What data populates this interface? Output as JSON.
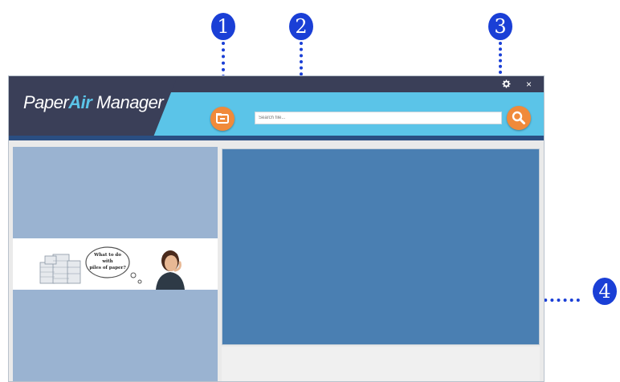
{
  "callouts": [
    {
      "number": "1"
    },
    {
      "number": "2"
    },
    {
      "number": "3"
    },
    {
      "number": "4"
    }
  ],
  "app": {
    "brand_part1": "Paper",
    "brand_part2": "Air",
    "brand_part3": " Manager"
  },
  "window_controls": {
    "settings_icon": "gear-icon",
    "close_glyph": "×"
  },
  "search": {
    "placeholder": "Search file...",
    "button_icon": "search-icon"
  },
  "toolbar": {
    "folder_button_icon": "folder-icon"
  },
  "banner": {
    "caption_line1": "What to do",
    "caption_line2": "with",
    "caption_line3": "piles of paper?"
  },
  "colors": {
    "header": "#5bc4e8",
    "dark_panel": "#3a3f58",
    "accent": "#f08a3a",
    "left_pane": "#9ab3d1",
    "preview_pane": "#4a7fb2",
    "callout": "#1a3fd6"
  }
}
